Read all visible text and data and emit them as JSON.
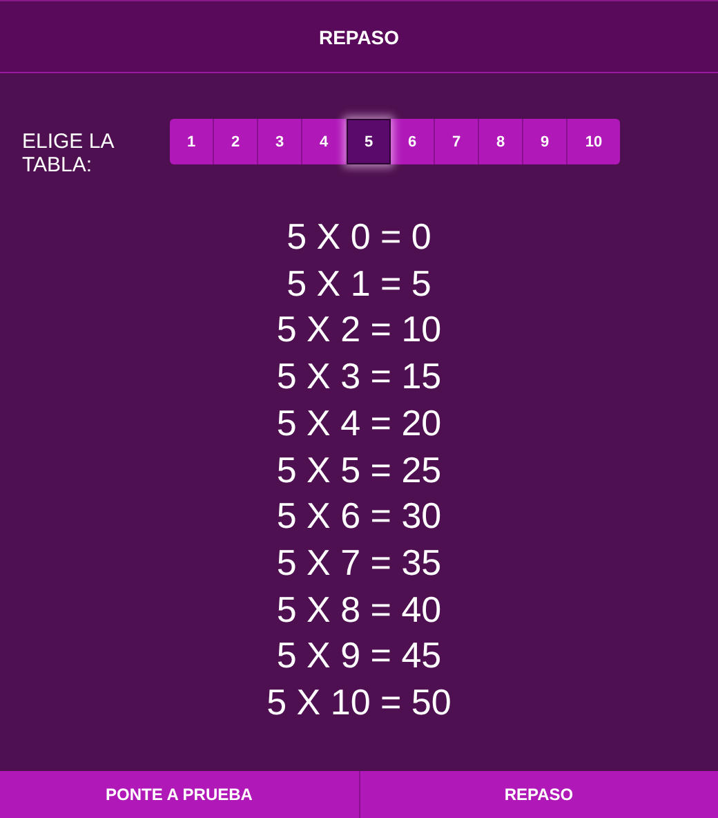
{
  "header": {
    "title": "REPASO"
  },
  "picker": {
    "label": "ELIGE LA TABLA:",
    "tables": [
      {
        "label": "1",
        "selected": false
      },
      {
        "label": "2",
        "selected": false
      },
      {
        "label": "3",
        "selected": false
      },
      {
        "label": "4",
        "selected": false
      },
      {
        "label": "5",
        "selected": true
      },
      {
        "label": "6",
        "selected": false
      },
      {
        "label": "7",
        "selected": false
      },
      {
        "label": "8",
        "selected": false
      },
      {
        "label": "9",
        "selected": false
      },
      {
        "label": "10",
        "selected": false
      }
    ]
  },
  "equations": [
    "5 X 0 = 0",
    "5 X 1 = 5",
    "5 X 2 = 10",
    "5 X 3 = 15",
    "5 X 4 = 20",
    "5 X 5 = 25",
    "5 X 6 = 30",
    "5 X 7 = 35",
    "5 X 8 = 40",
    "5 X 9 = 45",
    "5 X 10 = 50"
  ],
  "bottom_nav": [
    "PONTE A PRUEBA",
    "REPASO"
  ]
}
